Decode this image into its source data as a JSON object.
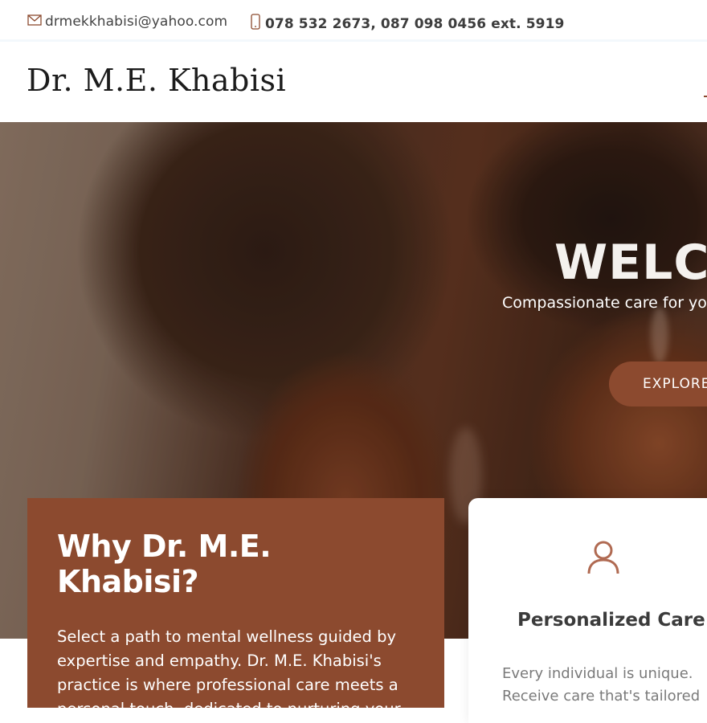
{
  "topbar": {
    "email": "drmekkhabisi@yahoo.com",
    "phone": "078 532 2673, 087 098 0456 ext. 5919",
    "email_icon": "envelope-icon",
    "phone_icon": "mobile-phone-icon"
  },
  "header": {
    "brand": "Dr. M.E. Khabisi"
  },
  "hero": {
    "title": "WELCO",
    "subtitle": "Compassionate care for yo",
    "button_label": "EXPLORE"
  },
  "why": {
    "title": "Why Dr. M.E. Khabisi?",
    "text": "Select a path to mental wellness guided by expertise and empathy. Dr. M.E. Khabisi's practice is where professional care meets a personal touch, dedicated to nurturing your mental health journey."
  },
  "feature": {
    "icon": "person-icon",
    "title": "Personalized Care",
    "line1": "Every individual is unique.",
    "line2": "Receive care that's tailored"
  },
  "colors": {
    "accent": "#8c4a2f",
    "text_dark": "#3b3b3b",
    "text_muted": "#7a7a7a"
  }
}
